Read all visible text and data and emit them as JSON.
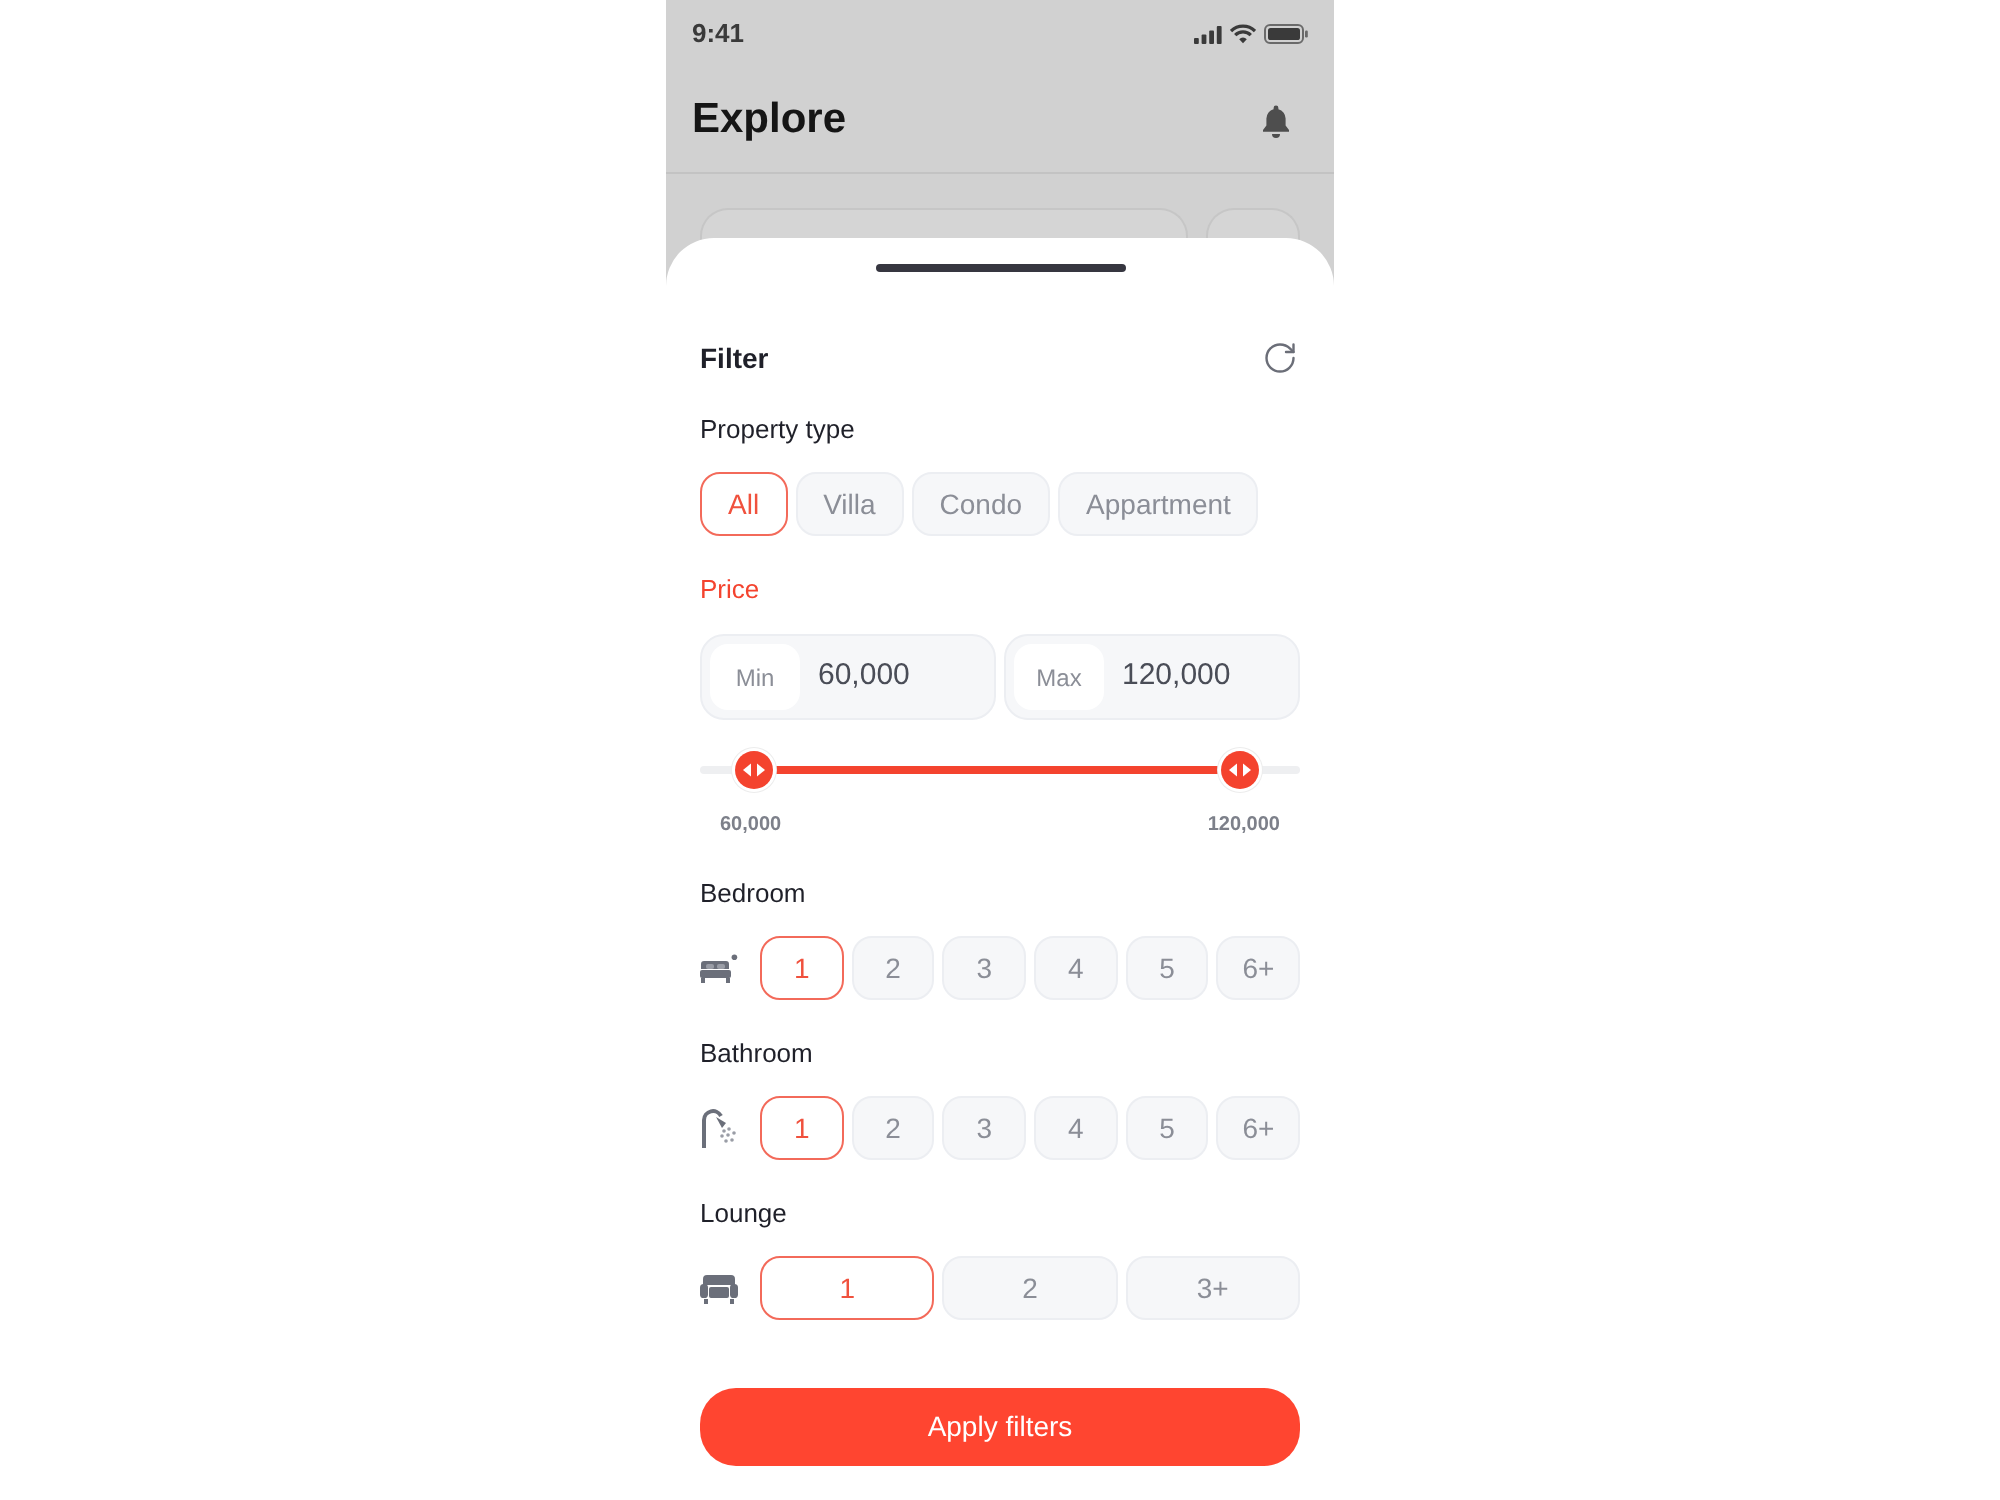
{
  "status_bar": {
    "time": "9:41"
  },
  "header": {
    "title": "Explore"
  },
  "sheet": {
    "title": "Filter"
  },
  "property_type": {
    "label": "Property type",
    "active": false,
    "options": [
      {
        "label": "All",
        "selected": true
      },
      {
        "label": "Villa",
        "selected": false
      },
      {
        "label": "Condo",
        "selected": false
      },
      {
        "label": "Appartment",
        "selected": false
      }
    ]
  },
  "price": {
    "label": "Price",
    "active": true,
    "min": {
      "label": "Min",
      "value": "60,000"
    },
    "max": {
      "label": "Max",
      "value": "120,000"
    },
    "slider": {
      "thumbs": [
        {
          "level": 0.09
        },
        {
          "level": 0.9
        }
      ],
      "min_label": "60,000",
      "max_label": "120,000"
    }
  },
  "rooms": [
    {
      "kind": "bed",
      "label": "Bedroom",
      "active": false,
      "options": [
        {
          "label": "1",
          "selected": true
        },
        {
          "label": "2",
          "selected": false
        },
        {
          "label": "3",
          "selected": false
        },
        {
          "label": "4",
          "selected": false
        },
        {
          "label": "5",
          "selected": false
        },
        {
          "label": "6+",
          "selected": false
        }
      ]
    },
    {
      "kind": "bath",
      "label": "Bathroom",
      "active": false,
      "options": [
        {
          "label": "1",
          "selected": true
        },
        {
          "label": "2",
          "selected": false
        },
        {
          "label": "3",
          "selected": false
        },
        {
          "label": "4",
          "selected": false
        },
        {
          "label": "5",
          "selected": false
        },
        {
          "label": "6+",
          "selected": false
        }
      ]
    },
    {
      "kind": "lounge",
      "label": "Lounge",
      "active": false,
      "options": [
        {
          "label": "1",
          "selected": true
        },
        {
          "label": "2",
          "selected": false
        },
        {
          "label": "3+",
          "selected": false
        }
      ]
    }
  ],
  "apply_button": {
    "label": "Apply filters"
  }
}
